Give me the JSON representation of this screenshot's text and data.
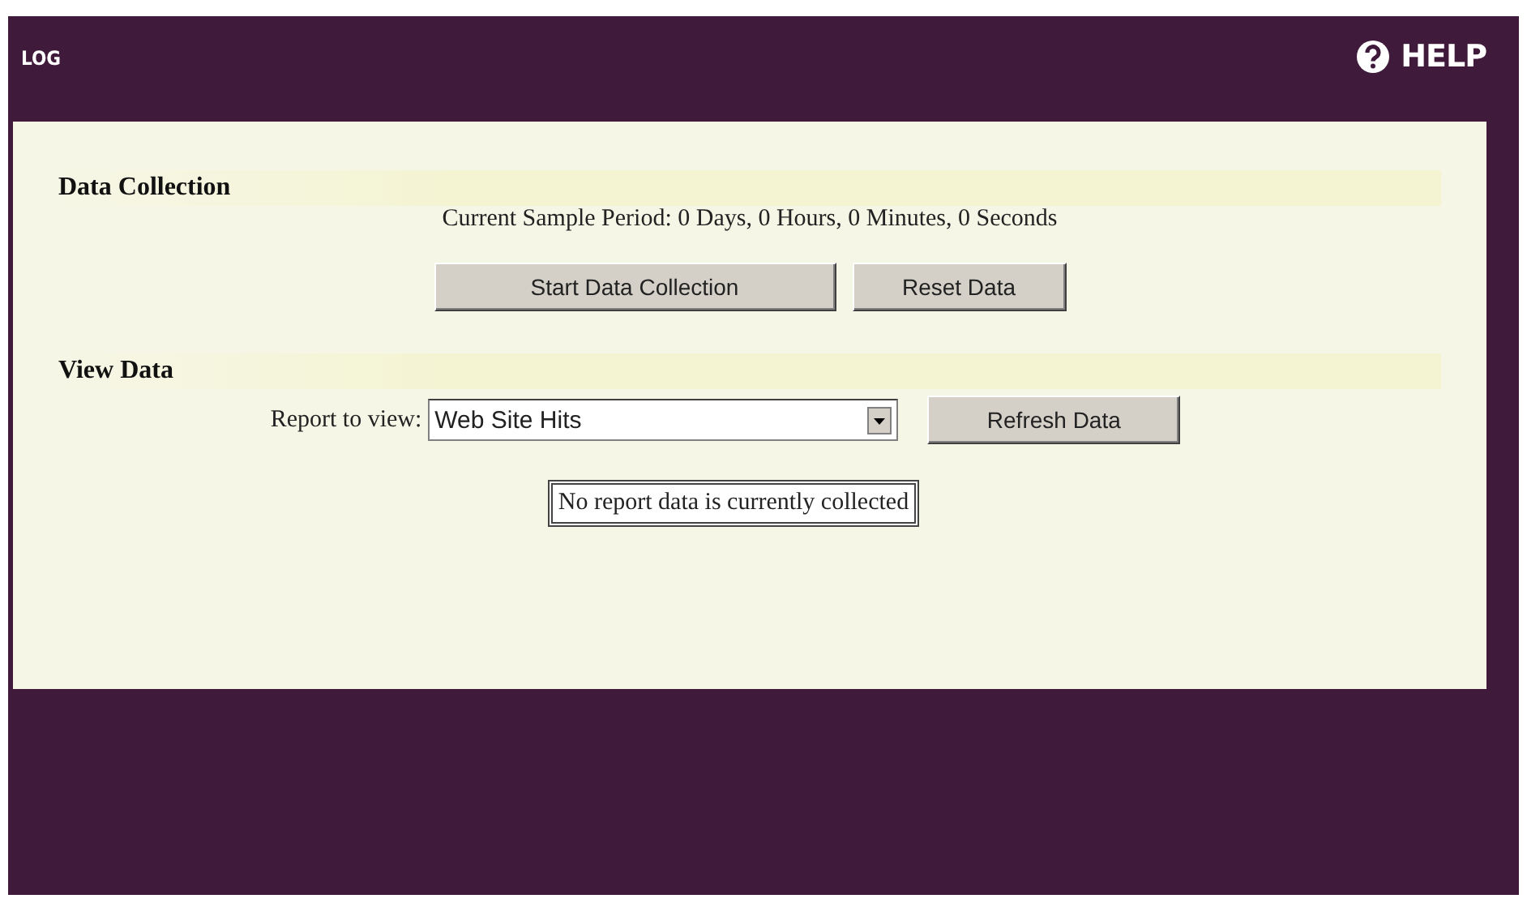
{
  "header": {
    "title": "LOG",
    "help": "HELP"
  },
  "data_collection": {
    "heading": "Data Collection",
    "period": "Current Sample Period: 0 Days, 0 Hours, 0 Minutes, 0 Seconds",
    "buttons": [
      "Start Data Collection",
      "Reset Data"
    ]
  },
  "view_data": {
    "heading": "View Data",
    "report_label": "Report to view:",
    "report_value": "Web Site Hits",
    "refresh_button": "Refresh Data",
    "message": "No report data is currently collected"
  }
}
